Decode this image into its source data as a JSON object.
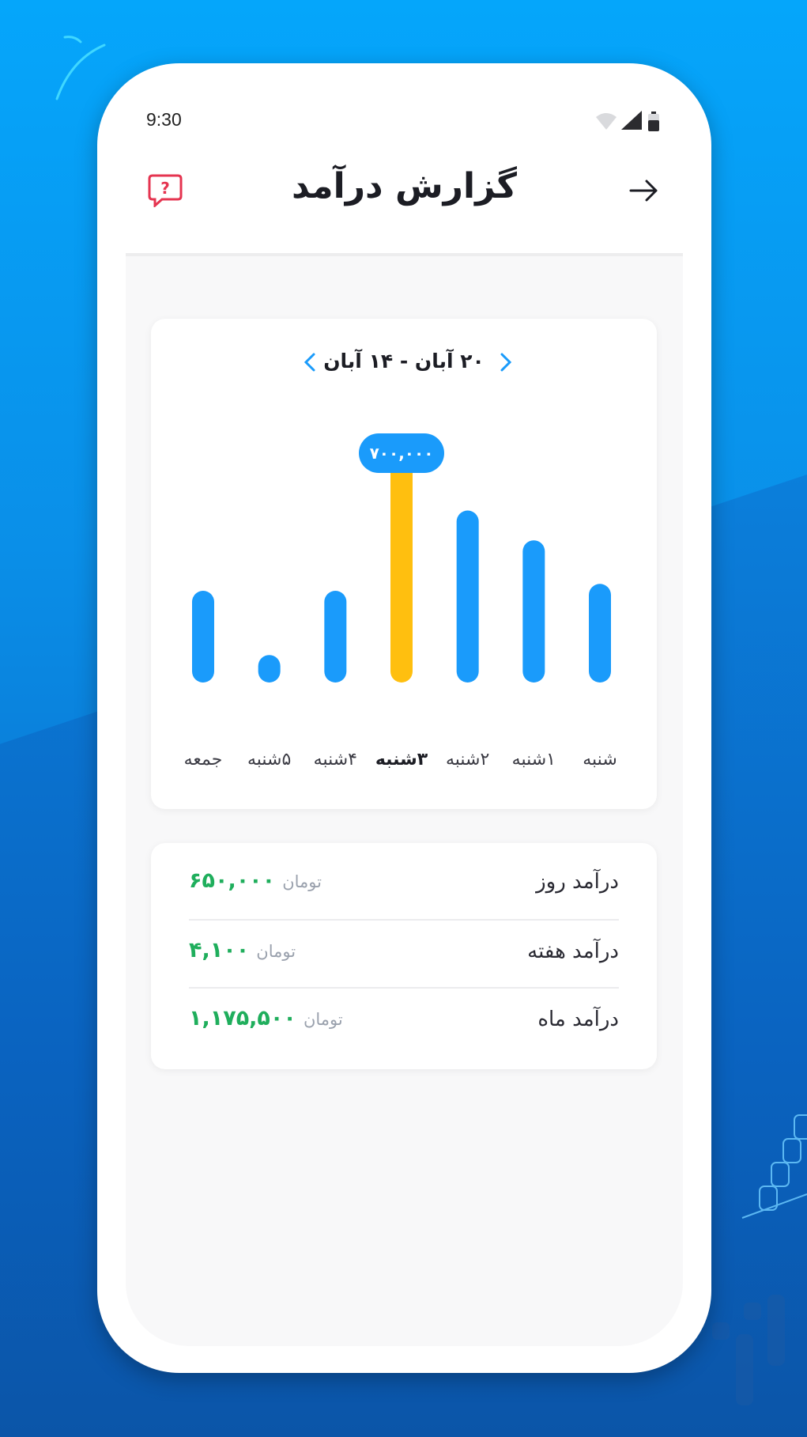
{
  "status_bar": {
    "time": "9:30"
  },
  "appbar": {
    "title": "گزارش درآمد"
  },
  "range": {
    "label": "۲۰ آبان - ۱۴ آبان"
  },
  "chart_data": {
    "type": "bar",
    "categories": [
      "شنبه",
      "۱شنبه",
      "۲شنبه",
      "۳شنبه",
      "۴شنبه",
      "۵شنبه",
      "جمعه"
    ],
    "values": [
      0.43,
      0.62,
      0.75,
      1.0,
      0.4,
      0.12,
      0.4
    ],
    "highlight_index": 3,
    "highlight_label": "۷۰۰,۰۰۰",
    "colors": {
      "bar": "#1a9bfb",
      "highlight": "#ffbf0f"
    }
  },
  "summary": [
    {
      "label": "درآمد روز",
      "amount": "۶۵۰,۰۰۰",
      "unit": "تومان"
    },
    {
      "label": "درآمد هفته",
      "amount": "۴,۱۰۰",
      "unit": "تومان"
    },
    {
      "label": "درآمد ماه",
      "amount": "۱,۱۷۵,۵۰۰",
      "unit": "تومان"
    }
  ]
}
